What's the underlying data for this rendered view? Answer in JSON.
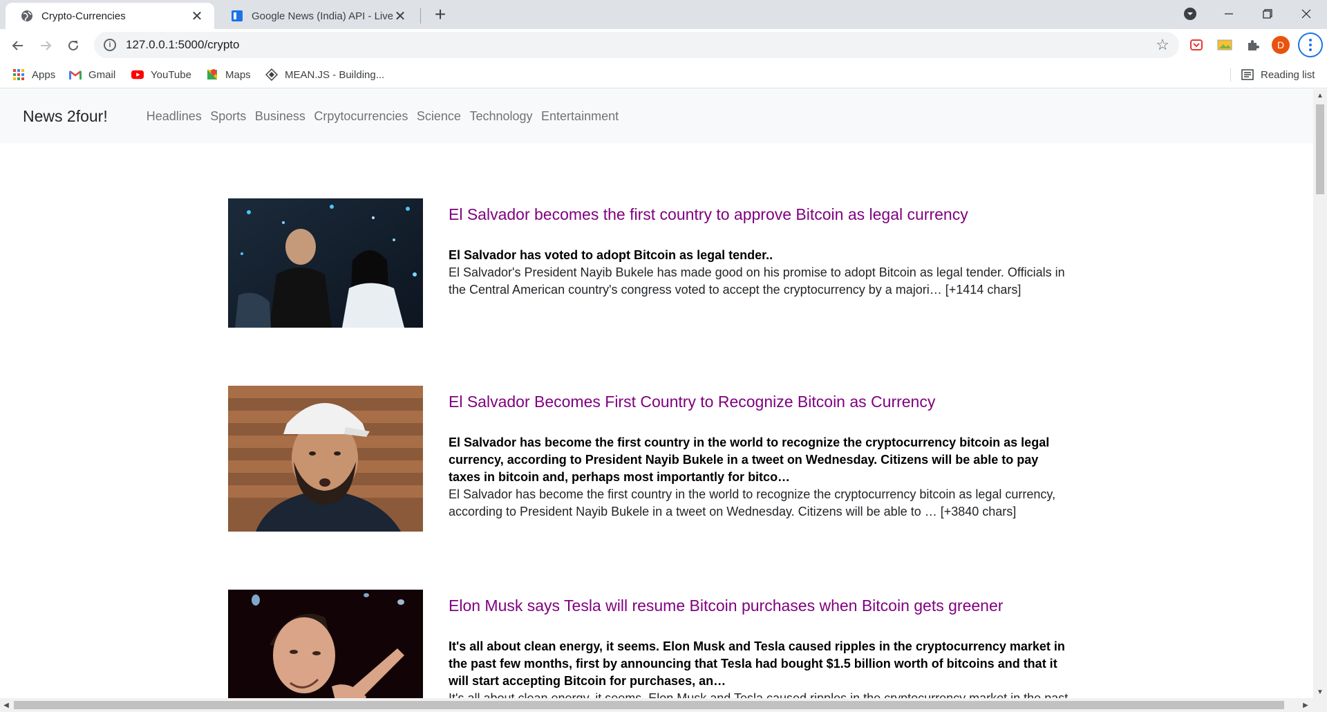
{
  "browser": {
    "tabs": [
      {
        "title": "Crypto-Currencies"
      },
      {
        "title": "Google News (India) API - Live ne"
      }
    ],
    "url": "127.0.0.1:5000/crypto",
    "profile_initial": "D",
    "bookmarks": [
      {
        "label": "Apps",
        "icon": "apps-grid-icon"
      },
      {
        "label": "Gmail",
        "icon": "gmail-icon"
      },
      {
        "label": "YouTube",
        "icon": "youtube-icon"
      },
      {
        "label": "Maps",
        "icon": "maps-icon"
      },
      {
        "label": "MEAN.JS - Building..."
      }
    ],
    "reading_list": "Reading list"
  },
  "site": {
    "brand": "News 2four!",
    "nav": [
      "Headlines",
      "Sports",
      "Business",
      "Crpytocurrencies",
      "Science",
      "Technology",
      "Entertainment"
    ]
  },
  "articles": [
    {
      "title": "El Salvador becomes the first country to approve Bitcoin as legal currency",
      "description": "El Salvador has voted to adopt Bitcoin as legal tender..",
      "content": "El Salvador's President Nayib Bukele has made good on his promise to adopt Bitcoin as legal tender. Officials in the Central American country's congress voted to accept the cryptocurrency by a majori… [+1414 chars]"
    },
    {
      "title": "El Salvador Becomes First Country to Recognize Bitcoin as Currency",
      "description": "El Salvador has become the first country in the world to recognize the cryptocurrency bitcoin as legal currency, according to President Nayib Bukele in a tweet on Wednesday. Citizens will be able to pay taxes in bitcoin and, perhaps most importantly for bitco…",
      "content": "El Salvador has become the first country in the world to recognize the cryptocurrency bitcoin as legal currency, according to President Nayib Bukele in a tweet on Wednesday. Citizens will be able to … [+3840 chars]"
    },
    {
      "title": "Elon Musk says Tesla will resume Bitcoin purchases when Bitcoin gets greener",
      "description": "It's all about clean energy, it seems.  Elon Musk and Tesla caused ripples in the cryptocurrency market in the past few months, first by announcing that Tesla had bought $1.5 billion worth of bitcoins and that it will start accepting Bitcoin for purchases, an…",
      "content": "It's all about clean energy, it seems.  Elon Musk and Tesla caused ripples in the cryptocurrency market in the past few months"
    }
  ],
  "colors": {
    "headline": "#800080",
    "navbar_bg": "#f8f9fa",
    "tabstrip_bg": "#dee1e6"
  }
}
